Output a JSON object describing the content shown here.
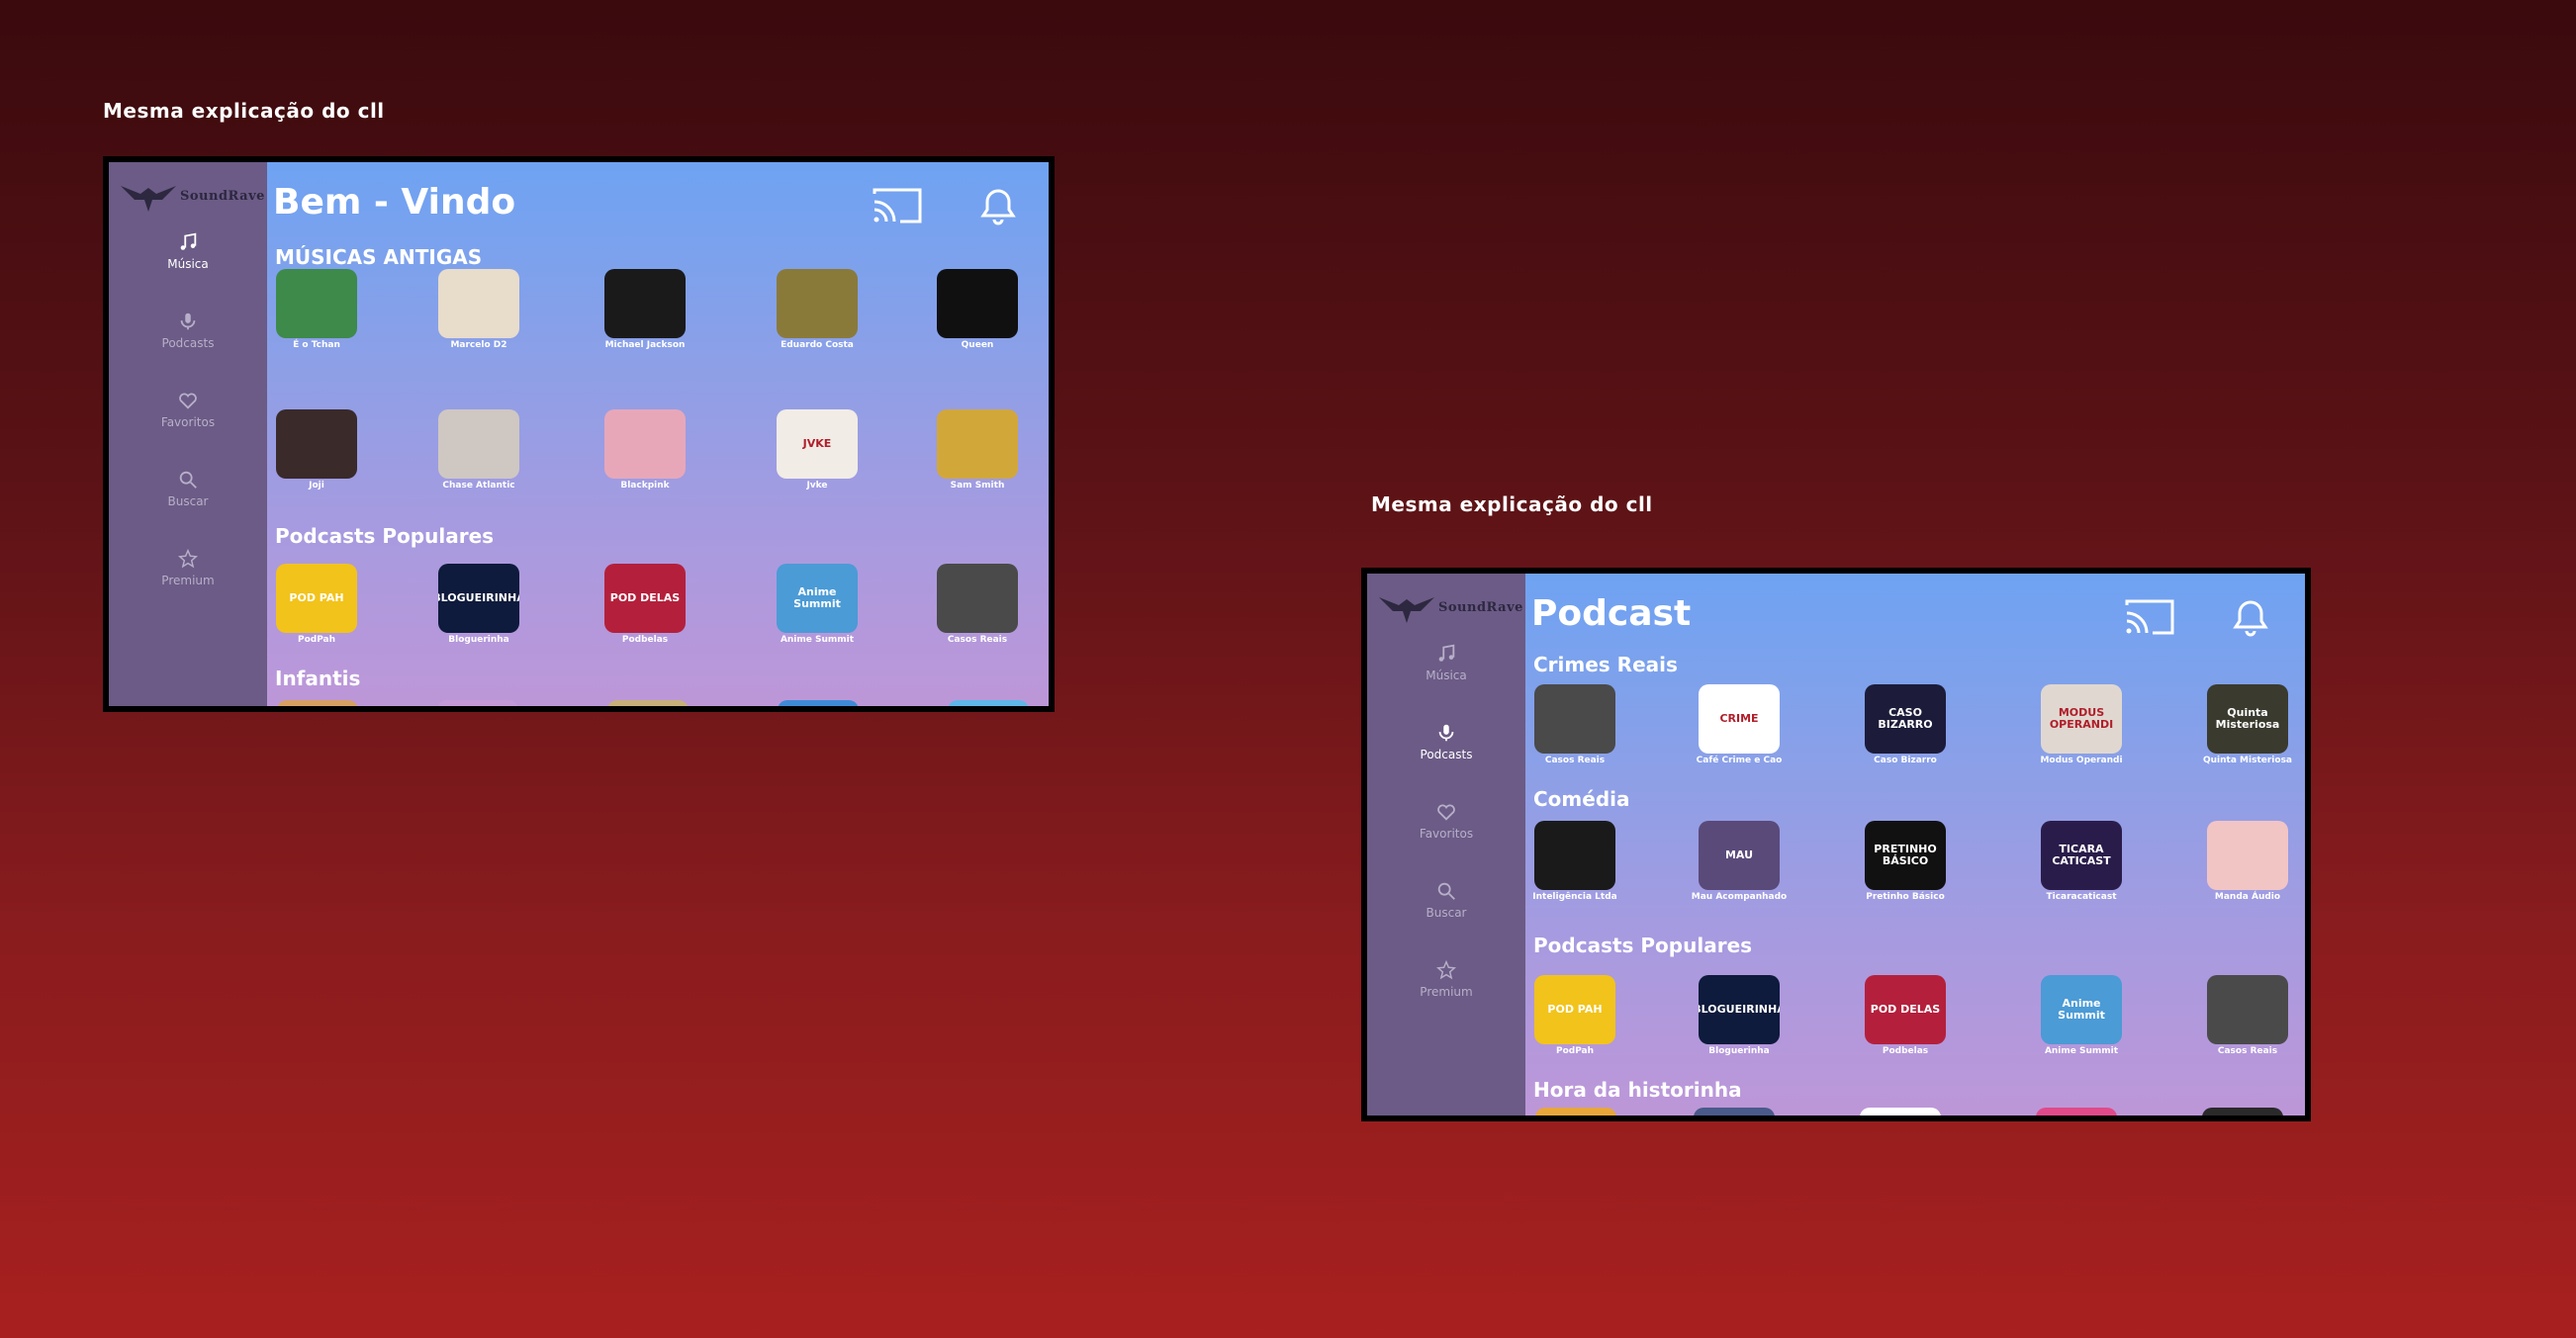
{
  "captions": {
    "left": "Mesma explicação do cll",
    "right": "Mesma explicação do cll"
  },
  "brand": {
    "name": "SoundRave"
  },
  "nav": [
    {
      "label": "Música",
      "icon": "music-note-icon"
    },
    {
      "label": "Podcasts",
      "icon": "microphone-icon"
    },
    {
      "label": "Favoritos",
      "icon": "heart-icon"
    },
    {
      "label": "Buscar",
      "icon": "search-icon"
    },
    {
      "label": "Premium",
      "icon": "star-icon"
    }
  ],
  "home": {
    "title": "Bem - Vindo",
    "active_nav": 0,
    "sections": [
      {
        "title": "MÚSICAS ANTIGAS",
        "items": [
          {
            "label": "É o Tchan",
            "color": "#3d8a4a",
            "text": ""
          },
          {
            "label": "Marcelo D2",
            "color": "#e8dccb",
            "text": ""
          },
          {
            "label": "Michael Jackson",
            "color": "#1a1a1a",
            "text": ""
          },
          {
            "label": "Eduardo Costa",
            "color": "#8a7a3a",
            "text": ""
          },
          {
            "label": "Queen",
            "color": "#101010",
            "text": ""
          }
        ]
      },
      {
        "title": "",
        "items": [
          {
            "label": "Joji",
            "color": "#3a2a2a",
            "text": ""
          },
          {
            "label": "Chase Atlantic",
            "color": "#cfc7c2",
            "text": ""
          },
          {
            "label": "Blackpink",
            "color": "#e7a7b9",
            "text": ""
          },
          {
            "label": "Jvke",
            "color": "#f1ece5",
            "text": "JVKE"
          },
          {
            "label": "Sam Smith",
            "color": "#d2a73a",
            "text": ""
          }
        ]
      },
      {
        "title": "Podcasts Populares",
        "items": [
          {
            "label": "PodPah",
            "color": "#f2c31b",
            "text": "POD PAH"
          },
          {
            "label": "Bloguerinha",
            "color": "#0e1b3c",
            "text": "BLOGUEIRINHA"
          },
          {
            "label": "Podbelas",
            "color": "#b4203c",
            "text": "POD DELAS"
          },
          {
            "label": "Anime Summit",
            "color": "#4b9bd6",
            "text": "Anime Summit"
          },
          {
            "label": "Casos Reais",
            "color": "#4a4a4a",
            "text": ""
          }
        ]
      },
      {
        "title": "Infantis",
        "items": []
      }
    ]
  },
  "podcast": {
    "title": "Podcast",
    "active_nav": 1,
    "sections": [
      {
        "title": "Crimes Reais",
        "items": [
          {
            "label": "Casos Reais",
            "color": "#4a4a4a",
            "text": ""
          },
          {
            "label": "Café Crime e Cao",
            "color": "#ffffff",
            "text": "CRIME"
          },
          {
            "label": "Caso Bizarro",
            "color": "#1c1c3a",
            "text": "CASO BIZARRO"
          },
          {
            "label": "Modus Operandi",
            "color": "#e0d8d0",
            "text": "MODUS OPERANDI"
          },
          {
            "label": "Quinta Misteriosa",
            "color": "#3a3a2e",
            "text": "Quinta Misteriosa"
          }
        ]
      },
      {
        "title": "Comédia",
        "items": [
          {
            "label": "Inteligência Ltda",
            "color": "#1a1a1a",
            "text": ""
          },
          {
            "label": "Mau Acompanhado",
            "color": "#5a4a7a",
            "text": "MAU"
          },
          {
            "label": "Pretinho Básico",
            "color": "#111111",
            "text": "PRETINHO BÁSICO"
          },
          {
            "label": "Ticaracaticast",
            "color": "#2a1c4a",
            "text": "TICARA CATICAST"
          },
          {
            "label": "Manda Áudio",
            "color": "#f2c5c5",
            "text": ""
          }
        ]
      },
      {
        "title": "Podcasts Populares",
        "items": [
          {
            "label": "PodPah",
            "color": "#f2c31b",
            "text": "POD PAH"
          },
          {
            "label": "Bloguerinha",
            "color": "#0e1b3c",
            "text": "BLOGUEIRINHA"
          },
          {
            "label": "Podbelas",
            "color": "#b4203c",
            "text": "POD DELAS"
          },
          {
            "label": "Anime Summit",
            "color": "#4b9bd6",
            "text": "Anime Summit"
          },
          {
            "label": "Casos Reais",
            "color": "#4a4a4a",
            "text": ""
          }
        ]
      },
      {
        "title": "Hora da historinha",
        "items": []
      }
    ]
  },
  "top_icons": [
    "cast-icon",
    "bell-icon",
    "gear-icon"
  ]
}
